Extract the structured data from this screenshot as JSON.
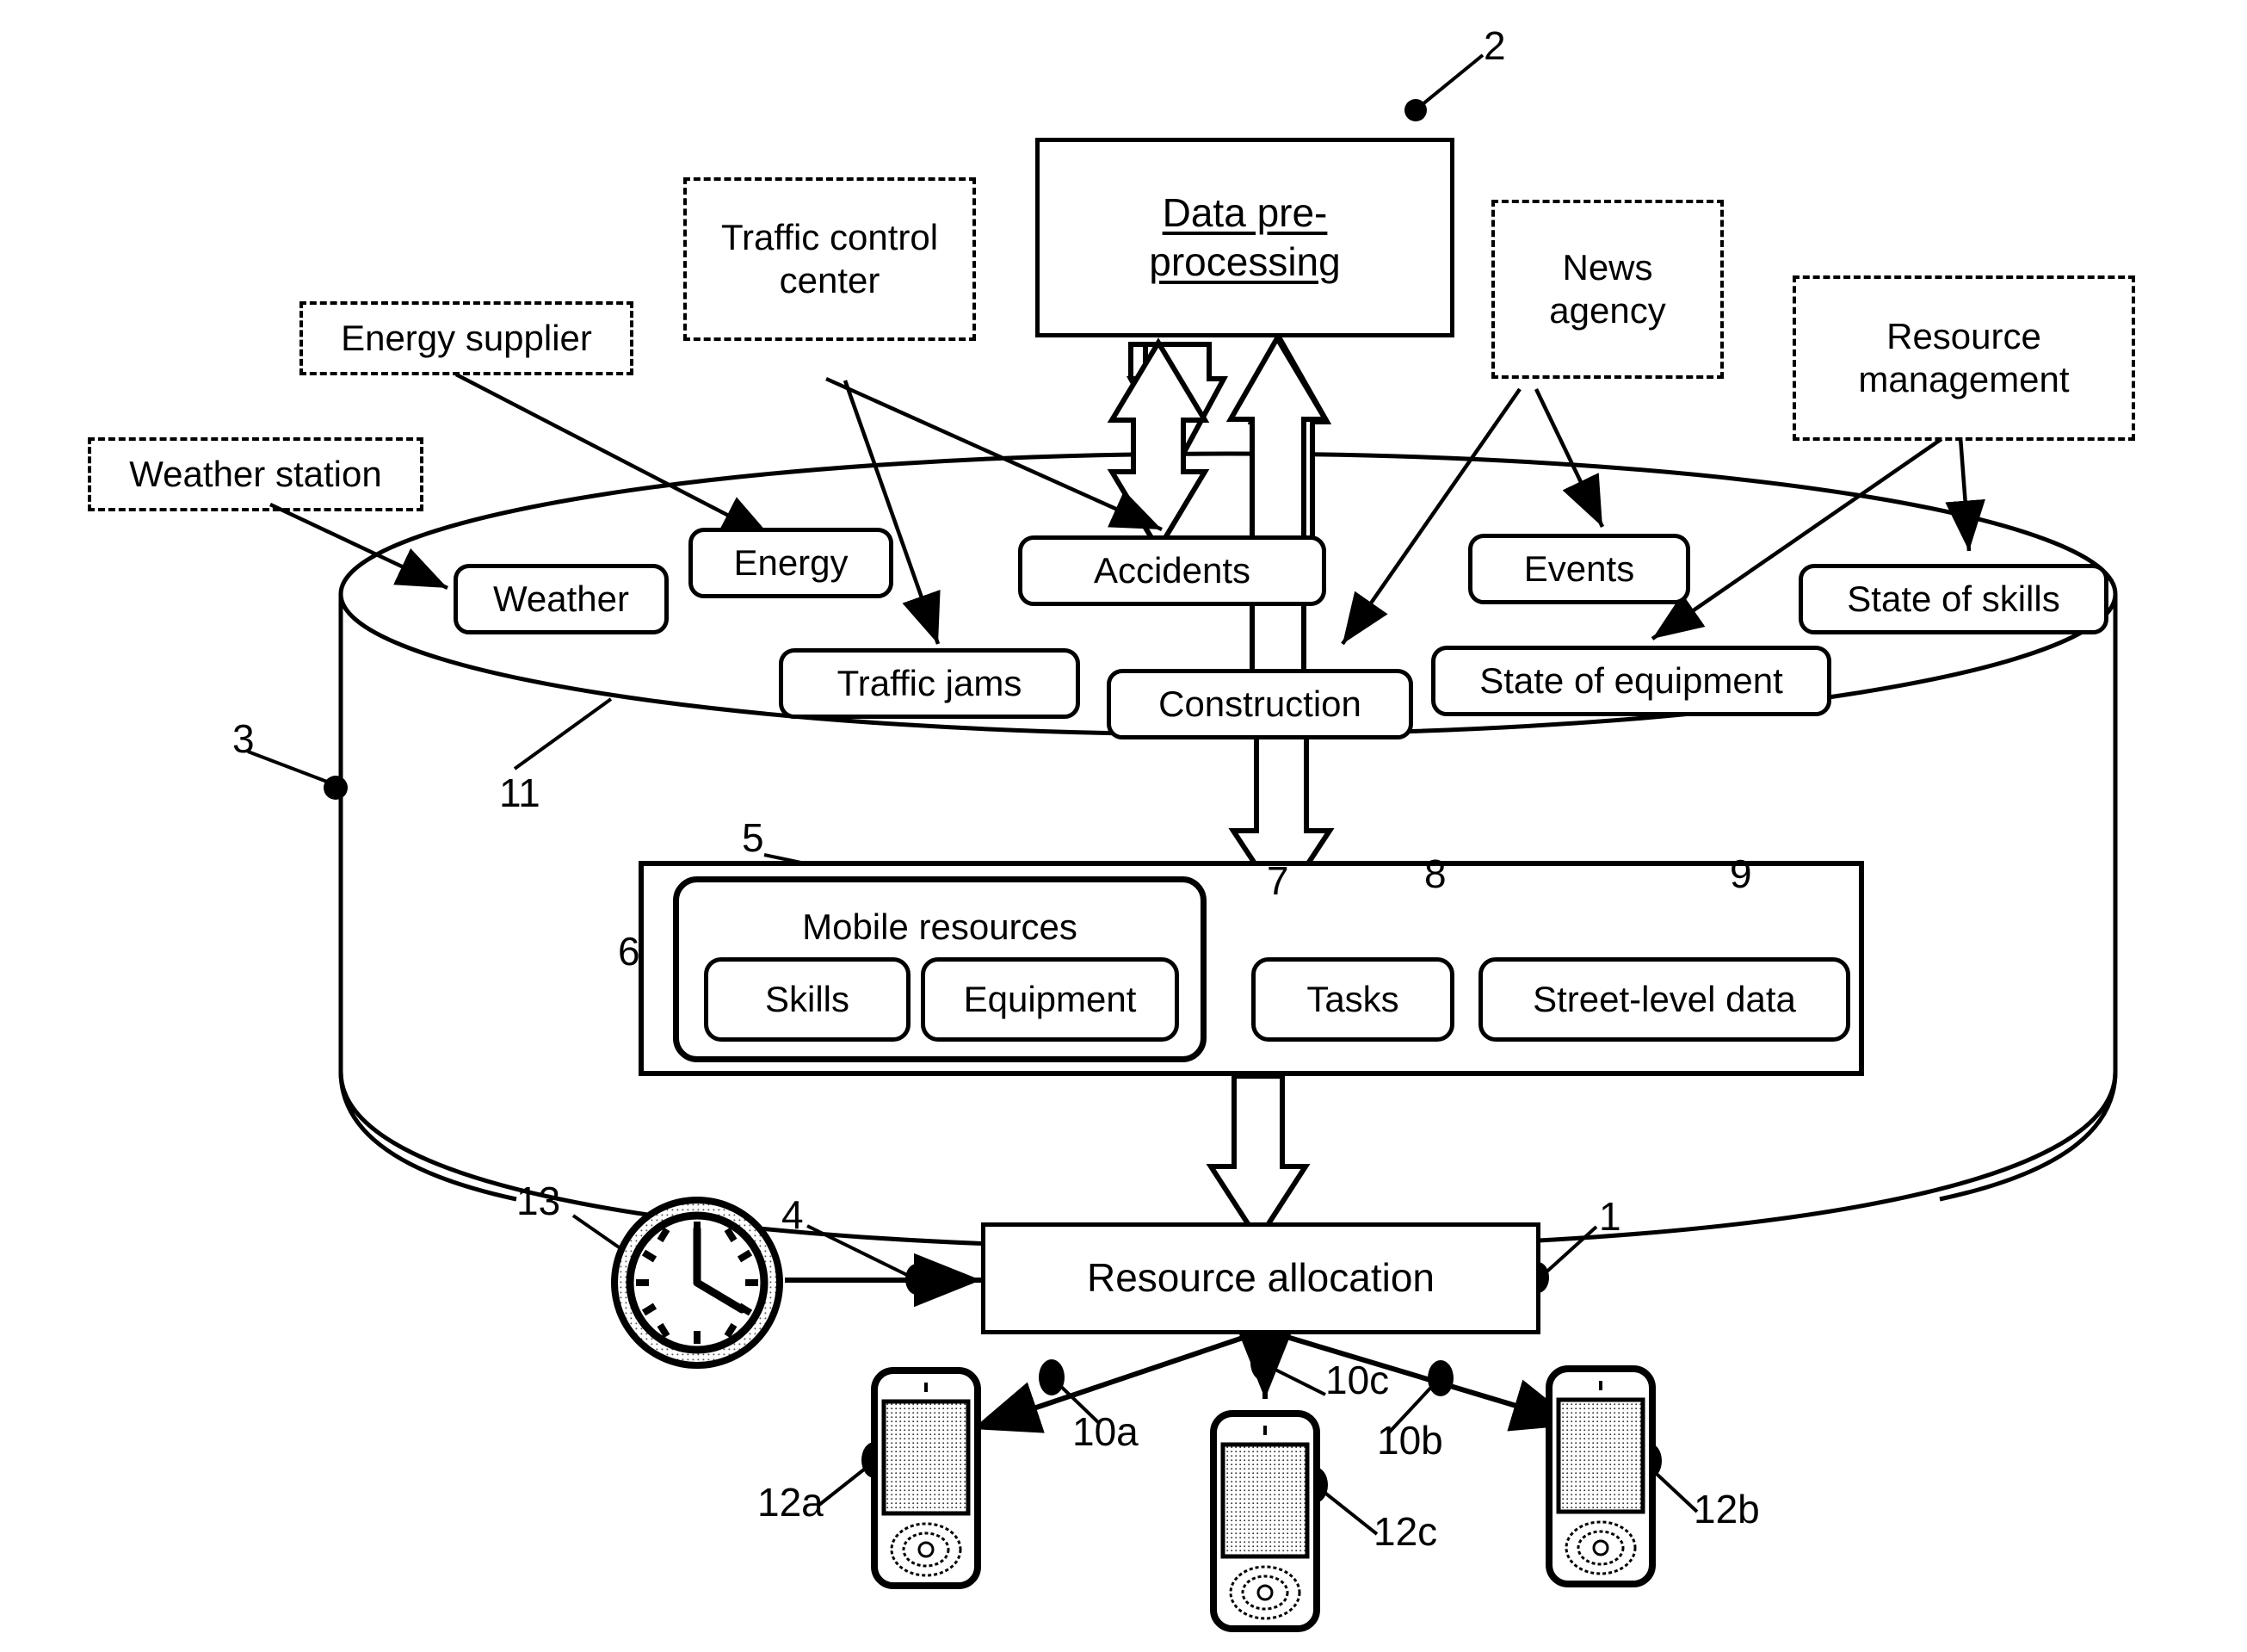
{
  "figure": {
    "title_box": {
      "line1": "Data pre-",
      "line2": "processing",
      "ref": "2"
    },
    "external_sources": [
      {
        "id": "weather-station",
        "label": "Weather station",
        "lines": [
          "Weather station"
        ]
      },
      {
        "id": "energy-supplier",
        "label": "Energy supplier",
        "lines": [
          "Energy supplier"
        ]
      },
      {
        "id": "traffic-control-center",
        "label": "Traffic control center",
        "lines": [
          "Traffic control",
          "center"
        ]
      },
      {
        "id": "news-agency",
        "label": "News agency",
        "lines": [
          "News",
          "agency"
        ]
      },
      {
        "id": "resource-management",
        "label": "Resource management",
        "lines": [
          "Resource",
          "management"
        ]
      }
    ],
    "database": {
      "ref_cylinder": "3",
      "ref_top_surface": "11",
      "data_nodes": [
        {
          "id": "weather",
          "label": "Weather"
        },
        {
          "id": "energy",
          "label": "Energy"
        },
        {
          "id": "accidents",
          "label": "Accidents"
        },
        {
          "id": "events",
          "label": "Events"
        },
        {
          "id": "state-of-skills",
          "label": "State of skills"
        },
        {
          "id": "traffic-jams",
          "label": "Traffic jams"
        },
        {
          "id": "construction",
          "label": "Construction"
        },
        {
          "id": "state-of-equipment",
          "label": "State of equipment"
        }
      ],
      "storage": {
        "mobile_resources": {
          "label": "Mobile resources",
          "ref": "5"
        },
        "skills": {
          "label": "Skills",
          "ref": "6"
        },
        "equipment": {
          "label": "Equipment",
          "ref": "7"
        },
        "tasks": {
          "label": "Tasks",
          "ref": "8"
        },
        "street_level": {
          "label": "Street-level data",
          "ref": "9"
        }
      }
    },
    "allocation": {
      "label": "Resource allocation",
      "ref": "1",
      "input_ref": "4",
      "clock_ref": "13",
      "clock_time": "12:20"
    },
    "devices": [
      {
        "id": "device-a",
        "device_ref": "12a",
        "link_ref": "10a"
      },
      {
        "id": "device-c",
        "device_ref": "12c",
        "link_ref": "10c"
      },
      {
        "id": "device-b",
        "device_ref": "12b",
        "link_ref": "10b"
      }
    ]
  }
}
